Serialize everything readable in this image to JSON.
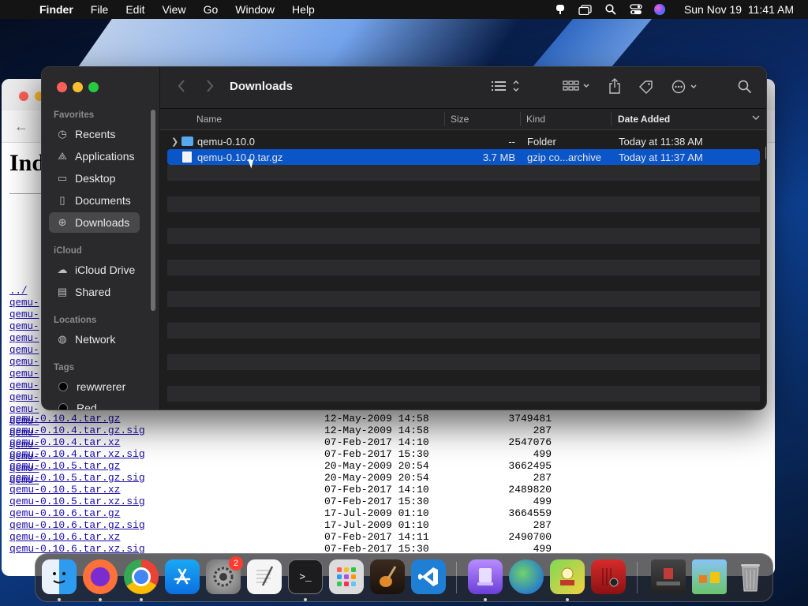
{
  "menubar": {
    "app_name": "Finder",
    "menus": [
      "File",
      "Edit",
      "View",
      "Go",
      "Window",
      "Help"
    ],
    "clock": "Sun Nov 19  11:41 AM"
  },
  "browser": {
    "heading": "Ind",
    "parent_link": "../",
    "left_links": [
      "qemu-",
      "qemu-",
      "qemu-",
      "qemu-",
      "qemu-",
      "qemu-",
      "qemu-",
      "qemu-",
      "qemu-",
      "qemu-",
      "qemu-",
      "qemu-",
      "qemu-",
      "qemu-",
      "qemu-",
      "qemu-"
    ],
    "listing": [
      {
        "name": "qemu-0.10.4.tar.gz",
        "date": "12-May-2009 14:58",
        "size": "3749481"
      },
      {
        "name": "qemu-0.10.4.tar.gz.sig",
        "date": "12-May-2009 14:58",
        "size": "287"
      },
      {
        "name": "qemu-0.10.4.tar.xz",
        "date": "07-Feb-2017 14:10",
        "size": "2547076"
      },
      {
        "name": "qemu-0.10.4.tar.xz.sig",
        "date": "07-Feb-2017 15:30",
        "size": "499"
      },
      {
        "name": "qemu-0.10.5.tar.gz",
        "date": "20-May-2009 20:54",
        "size": "3662495"
      },
      {
        "name": "qemu-0.10.5.tar.gz.sig",
        "date": "20-May-2009 20:54",
        "size": "287"
      },
      {
        "name": "qemu-0.10.5.tar.xz",
        "date": "07-Feb-2017 14:10",
        "size": "2489820"
      },
      {
        "name": "qemu-0.10.5.tar.xz.sig",
        "date": "07-Feb-2017 15:30",
        "size": "499"
      },
      {
        "name": "qemu-0.10.6.tar.gz",
        "date": "17-Jul-2009 01:10",
        "size": "3664559"
      },
      {
        "name": "qemu-0.10.6.tar.gz.sig",
        "date": "17-Jul-2009 01:10",
        "size": "287"
      },
      {
        "name": "qemu-0.10.6.tar.xz",
        "date": "07-Feb-2017 14:11",
        "size": "2490700"
      },
      {
        "name": "qemu-0.10.6.tar.xz.sig",
        "date": "07-Feb-2017 15:30",
        "size": "499"
      }
    ]
  },
  "finder": {
    "title": "Downloads",
    "sidebar": {
      "favorites_label": "Favorites",
      "favorites": [
        "Recents",
        "Applications",
        "Desktop",
        "Documents",
        "Downloads"
      ],
      "icloud_label": "iCloud",
      "icloud": [
        "iCloud Drive",
        "Shared"
      ],
      "locations_label": "Locations",
      "locations": [
        "Network"
      ],
      "tags_label": "Tags",
      "tags": [
        "rewwrerer",
        "Red"
      ]
    },
    "columns": {
      "name": "Name",
      "size": "Size",
      "kind": "Kind",
      "date": "Date Added"
    },
    "files": [
      {
        "name": "qemu-0.10.0",
        "size": "--",
        "kind": "Folder",
        "date": "Today at 11:38 AM"
      },
      {
        "name": "qemu-0.10.0.tar.gz",
        "size": "3.7 MB",
        "kind": "gzip co...archive",
        "date": "Today at 11:37 AM"
      }
    ]
  },
  "dock": {
    "settings_badge": "2",
    "colors": {
      "finder": "#2d9cf0",
      "firefox": "#ff7139",
      "vscode": "#1f7fd4"
    }
  }
}
